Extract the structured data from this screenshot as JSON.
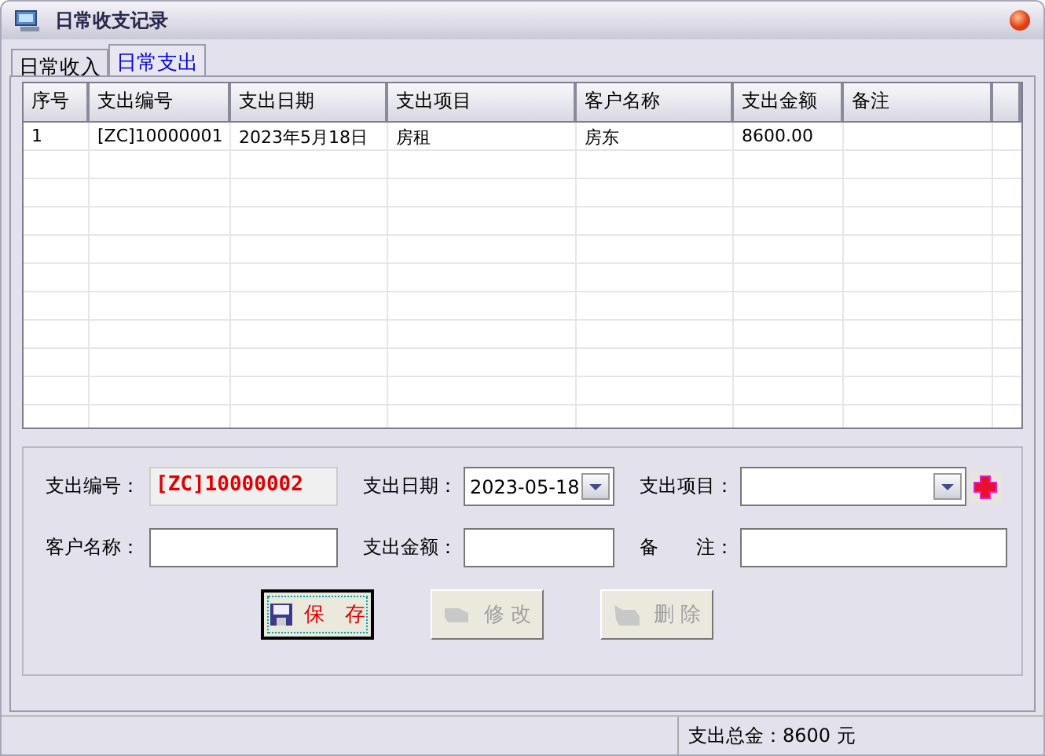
{
  "window": {
    "title": "日常收支记录"
  },
  "tabs": [
    {
      "label": "日常收入",
      "selected": false
    },
    {
      "label": "日常支出",
      "selected": true
    }
  ],
  "table": {
    "columns": [
      "序号",
      "支出编号",
      "支出日期",
      "支出项目",
      "客户名称",
      "支出金额",
      "备注"
    ],
    "rows": [
      [
        "1",
        "[ZC]10000001",
        "2023年5月18日",
        "房租",
        "房东",
        "8600.00",
        ""
      ]
    ]
  },
  "form": {
    "fields": [
      {
        "kind": "readonly",
        "label": "支出编号：",
        "value": "[ZC]10000002"
      },
      {
        "kind": "date",
        "label": "支出日期：",
        "value": "2023-05-18"
      },
      {
        "kind": "combo",
        "label": "支出项目："
      },
      {
        "kind": "text",
        "label": "客户名称："
      },
      {
        "kind": "text",
        "label": "支出金额："
      },
      {
        "kind": "text",
        "label": "备　　注："
      }
    ]
  },
  "buttons": [
    {
      "label": "保　存",
      "kind": "save",
      "disabled": false,
      "focused": true
    },
    {
      "label": "修 改",
      "kind": "edit",
      "disabled": true,
      "focused": false
    },
    {
      "label": "删 除",
      "kind": "delete",
      "disabled": true,
      "focused": false
    }
  ],
  "status_bar": {
    "total": "支出总金：8600 元"
  }
}
